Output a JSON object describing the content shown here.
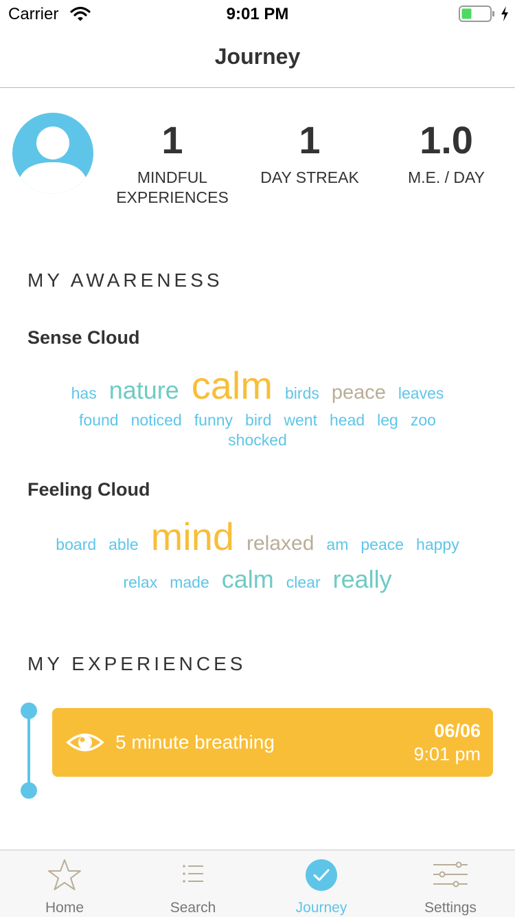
{
  "status_bar": {
    "carrier": "Carrier",
    "time": "9:01 PM"
  },
  "nav": {
    "title": "Journey"
  },
  "stats": [
    {
      "value": "1",
      "label_line1": "MINDFUL",
      "label_line2": "EXPERIENCES"
    },
    {
      "value": "1",
      "label_line1": "DAY STREAK",
      "label_line2": ""
    },
    {
      "value": "1.0",
      "label_line1": "M.E. / DAY",
      "label_line2": ""
    }
  ],
  "awareness": {
    "heading": "MY AWARENESS",
    "sense_cloud": {
      "title": "Sense Cloud",
      "row1": [
        "has",
        "nature",
        "calm",
        "birds",
        "peace",
        "leaves"
      ],
      "row2": [
        "found",
        "noticed",
        "funny",
        "bird",
        "went",
        "head",
        "leg",
        "zoo"
      ],
      "row3": [
        "shocked"
      ]
    },
    "feeling_cloud": {
      "title": "Feeling Cloud",
      "row1": [
        "board",
        "able",
        "mind",
        "relaxed",
        "am",
        "peace",
        "happy"
      ],
      "row2": [
        "relax",
        "made",
        "calm",
        "clear",
        "really"
      ]
    }
  },
  "experiences": {
    "heading": "MY EXPERIENCES",
    "items": [
      {
        "title": "5 minute breathing",
        "date": "06/06",
        "time": "9:01 pm",
        "icon": "eye-icon"
      }
    ]
  },
  "tabs": [
    {
      "label": "Home",
      "icon": "star-icon",
      "active": false
    },
    {
      "label": "Search",
      "icon": "list-icon",
      "active": false
    },
    {
      "label": "Journey",
      "icon": "checkmark-circle-icon",
      "active": true
    },
    {
      "label": "Settings",
      "icon": "sliders-icon",
      "active": false
    }
  ],
  "colors": {
    "accent_blue": "#5ec5e8",
    "teal": "#6dcbc4",
    "gold": "#f8be37",
    "taupe": "#b9ad98",
    "card": "#f8be37"
  }
}
